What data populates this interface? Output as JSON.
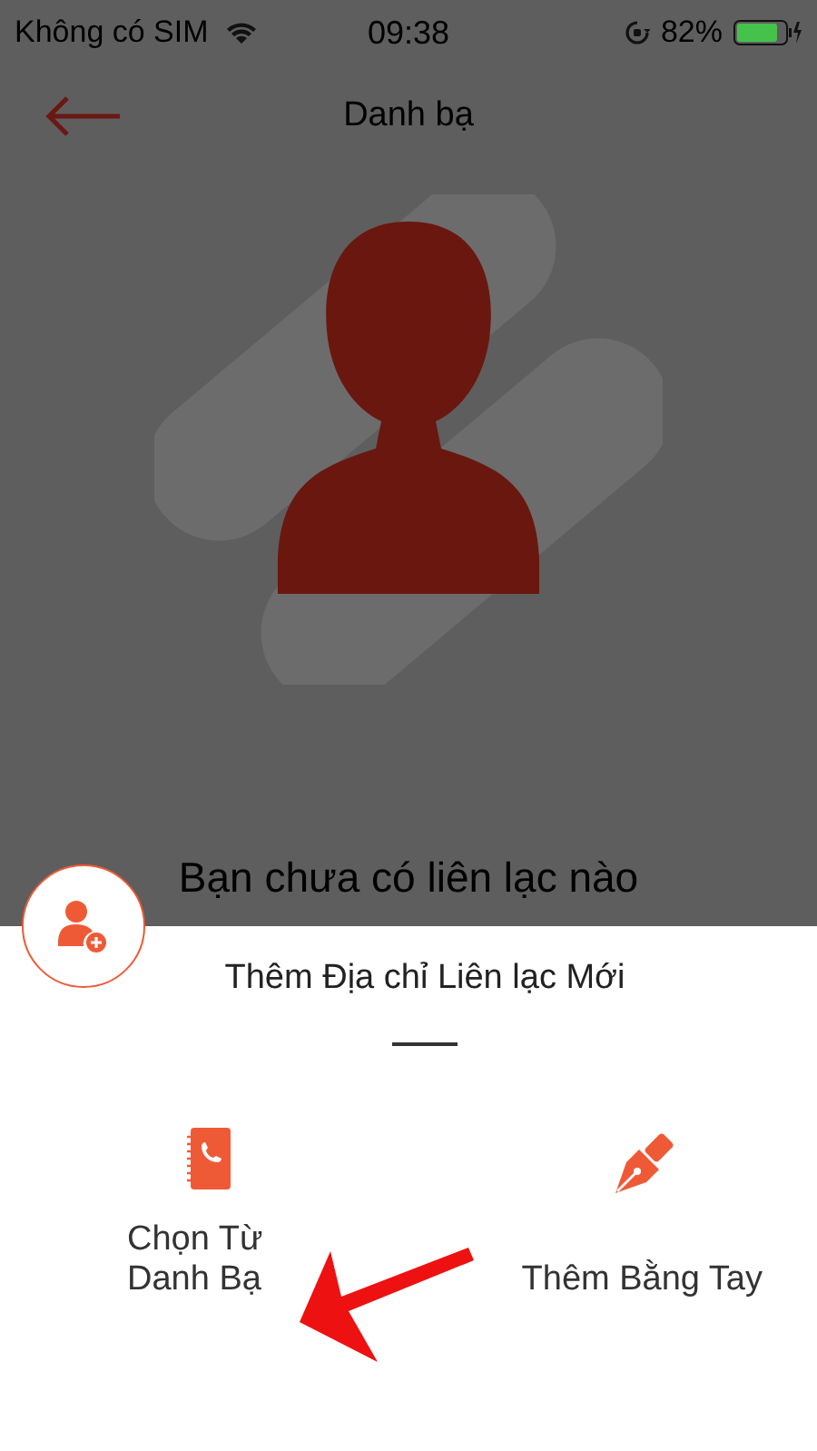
{
  "status_bar": {
    "carrier": "Không có SIM",
    "time": "09:38",
    "battery": "82%"
  },
  "header": {
    "title": "Danh bạ"
  },
  "empty_state": {
    "message": "Bạn chưa có liên lạc nào"
  },
  "sheet": {
    "title": "Thêm Địa chỉ Liên lạc Mới",
    "actions": [
      {
        "kind": "contacts",
        "label": "Chọn Từ Danh Bạ"
      },
      {
        "kind": "manual",
        "label": "Thêm Bằng Tay"
      }
    ]
  }
}
